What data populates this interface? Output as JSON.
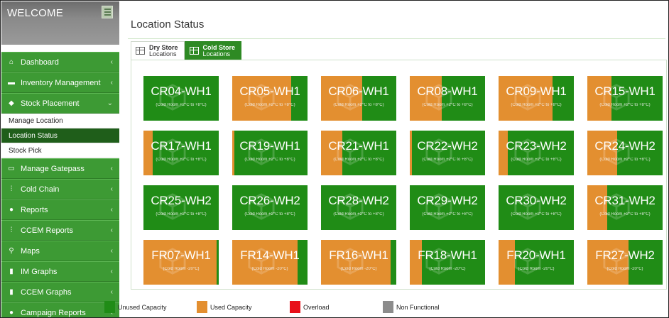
{
  "sidebar": {
    "title": "WELCOME",
    "items": [
      {
        "label": "Dashboard",
        "icon": "home-icon",
        "glyph": "⌂"
      },
      {
        "label": "Inventory Management",
        "icon": "inventory-icon",
        "glyph": "▬"
      },
      {
        "label": "Stock Placement",
        "icon": "placement-icon",
        "glyph": "◆"
      }
    ],
    "subitems": [
      {
        "label": "Manage Location"
      },
      {
        "label": "Location Status"
      },
      {
        "label": "Stock Pick"
      }
    ],
    "items_after": [
      {
        "label": "Manage Gatepass",
        "icon": "gatepass-icon",
        "glyph": "▭"
      },
      {
        "label": "Cold Chain",
        "icon": "thermometer-icon",
        "glyph": "⫶"
      },
      {
        "label": "Reports",
        "icon": "reports-icon",
        "glyph": "●"
      },
      {
        "label": "CCEM Reports",
        "icon": "thermometer-icon",
        "glyph": "⫶"
      },
      {
        "label": "Maps",
        "icon": "map-pin-icon",
        "glyph": "⚲"
      },
      {
        "label": "IM Graphs",
        "icon": "bar-chart-icon",
        "glyph": "▮"
      },
      {
        "label": "CCEM Graphs",
        "icon": "bar-chart-icon",
        "glyph": "▮"
      },
      {
        "label": "Campaign Reports",
        "icon": "campaign-icon",
        "glyph": "●"
      }
    ]
  },
  "main": {
    "title": "Location Status",
    "tabs": [
      {
        "top": "Dry Store",
        "bottom": "Locations",
        "active": false
      },
      {
        "top": "Cold Store",
        "bottom": "Locations",
        "active": true
      }
    ]
  },
  "colors": {
    "unused": "#208c16",
    "used": "#e38f30",
    "overload": "#e8101a",
    "non_functional": "#8c8c8c"
  },
  "locations": [
    {
      "name": "CR04-WH1",
      "temp": "(Cold Room +2°C to +8°C)",
      "used_fraction": 0.0
    },
    {
      "name": "CR05-WH1",
      "temp": "(Cold Room +2°C to +8°C)",
      "used_fraction": 0.78
    },
    {
      "name": "CR06-WH1",
      "temp": "(Cold Room +2°C to +8°C)",
      "used_fraction": 0.55
    },
    {
      "name": "CR08-WH1",
      "temp": "(Cold Room +2°C to +8°C)",
      "used_fraction": 0.42
    },
    {
      "name": "CR09-WH1",
      "temp": "(Cold Room +2°C to +8°C)",
      "used_fraction": 0.72
    },
    {
      "name": "CR15-WH1",
      "temp": "(Cold Room +2°C to +8°C)",
      "used_fraction": 0.32
    },
    {
      "name": "CR17-WH1",
      "temp": "(Cold Room +2°C to +8°C)",
      "used_fraction": 0.12
    },
    {
      "name": "CR19-WH1",
      "temp": "(Cold Room +2°C to +8°C)",
      "used_fraction": 0.03
    },
    {
      "name": "CR21-WH1",
      "temp": "(Cold Room +2°C to +8°C)",
      "used_fraction": 0.28
    },
    {
      "name": "CR22-WH2",
      "temp": "(Cold Room +2°C to +8°C)",
      "used_fraction": 0.03
    },
    {
      "name": "CR23-WH2",
      "temp": "(Cold Room +2°C to +8°C)",
      "used_fraction": 0.12
    },
    {
      "name": "CR24-WH2",
      "temp": "(Cold Room +2°C to +8°C)",
      "used_fraction": 0.4
    },
    {
      "name": "CR25-WH2",
      "temp": "(Cold Room +2°C to +8°C)",
      "used_fraction": 0.0
    },
    {
      "name": "CR26-WH2",
      "temp": "(Cold Room +2°C to +8°C)",
      "used_fraction": 0.0
    },
    {
      "name": "CR28-WH2",
      "temp": "(Cold Room +2°C to +8°C)",
      "used_fraction": 0.0
    },
    {
      "name": "CR29-WH2",
      "temp": "(Cold Room +2°C to +8°C)",
      "used_fraction": 0.0
    },
    {
      "name": "CR30-WH2",
      "temp": "(Cold Room +2°C to +8°C)",
      "used_fraction": 0.0
    },
    {
      "name": "CR31-WH2",
      "temp": "(Cold Room +2°C to +8°C)",
      "used_fraction": 0.26
    },
    {
      "name": "FR07-WH1",
      "temp": "(Cold Room -20°C)",
      "used_fraction": 0.97
    },
    {
      "name": "FR14-WH1",
      "temp": "(Cold Room -20°C)",
      "used_fraction": 0.87
    },
    {
      "name": "FR16-WH1",
      "temp": "(Cold Room -20°C)",
      "used_fraction": 0.92
    },
    {
      "name": "FR18-WH1",
      "temp": "(Cold Room -20°C)",
      "used_fraction": 0.16
    },
    {
      "name": "FR20-WH1",
      "temp": "(Cold Room -20°C)",
      "used_fraction": 0.22
    },
    {
      "name": "FR27-WH2",
      "temp": "(Cold Room -20°C)",
      "used_fraction": 0.55
    }
  ],
  "legend": [
    {
      "label": "Unused Capacity",
      "color": "#208c16"
    },
    {
      "label": "Used Capacity",
      "color": "#e38f30"
    },
    {
      "label": "Overload",
      "color": "#e8101a"
    },
    {
      "label": "Non Functional",
      "color": "#8c8c8c"
    }
  ]
}
